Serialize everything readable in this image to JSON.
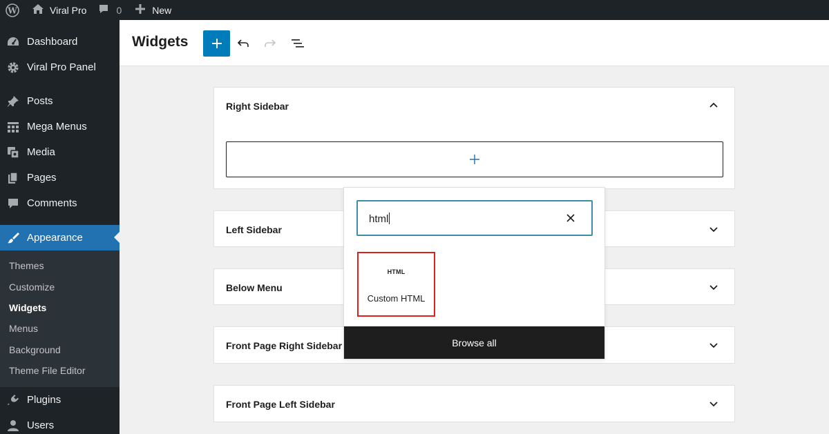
{
  "adminbar": {
    "site_name": "Viral Pro",
    "comments_count": "0",
    "new_label": "New"
  },
  "sidebar": {
    "items": [
      {
        "label": "Dashboard",
        "icon": "dashboard-icon"
      },
      {
        "label": "Viral Pro Panel",
        "icon": "gear-icon"
      },
      {
        "label": "Posts",
        "icon": "pushpin-icon"
      },
      {
        "label": "Mega Menus",
        "icon": "grid-icon"
      },
      {
        "label": "Media",
        "icon": "media-icon"
      },
      {
        "label": "Pages",
        "icon": "pages-icon"
      },
      {
        "label": "Comments",
        "icon": "comment-icon"
      },
      {
        "label": "Appearance",
        "icon": "paintbrush-icon"
      },
      {
        "label": "Plugins",
        "icon": "plug-icon"
      },
      {
        "label": "Users",
        "icon": "user-icon"
      }
    ],
    "submenu": [
      "Themes",
      "Customize",
      "Widgets",
      "Menus",
      "Background",
      "Theme File Editor"
    ]
  },
  "header": {
    "title": "Widgets"
  },
  "widget_areas": [
    {
      "title": "Right Sidebar",
      "expanded": true
    },
    {
      "title": "Left Sidebar",
      "expanded": false
    },
    {
      "title": "Below Menu",
      "expanded": false
    },
    {
      "title": "Front Page Right Sidebar",
      "expanded": false
    },
    {
      "title": "Front Page Left Sidebar",
      "expanded": false
    }
  ],
  "inserter": {
    "search_value": "html",
    "result_icon_text": "HTML",
    "result_label": "Custom HTML",
    "browse_all_label": "Browse all"
  },
  "colors": {
    "admin_dark": "#1d2327",
    "submenu_bg": "#2c3338",
    "accent_blue": "#2271b1",
    "primary_button": "#007cba",
    "search_focus": "#3b8ea5",
    "highlight_red": "#dd1f1f"
  }
}
